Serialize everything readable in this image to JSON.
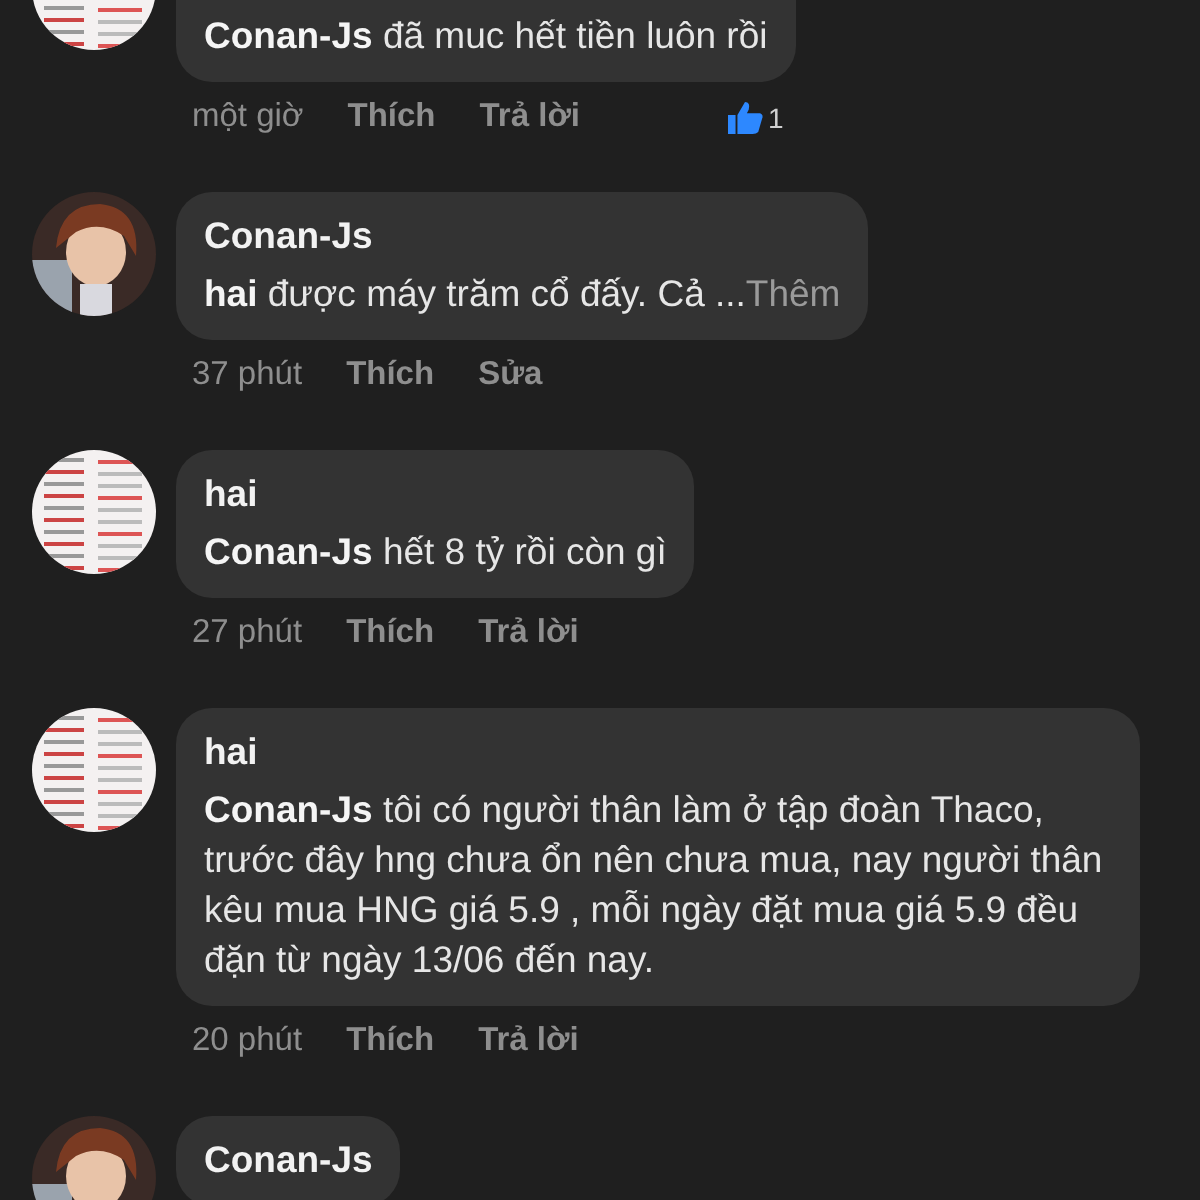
{
  "comments": [
    {
      "avatar": {
        "kind": "collage"
      },
      "tag": "Conan-Js",
      "text": "đã muc hết tiền luôn rồi",
      "meta": {
        "time": "một giờ",
        "actions": [
          "Thích",
          "Trả lời"
        ]
      },
      "reactions": {
        "count": "1"
      }
    },
    {
      "avatar": {
        "kind": "portrait"
      },
      "author": "Conan-Js",
      "tag": "hai",
      "text": "được máy trăm cổ đấy. Cả ...",
      "more": "Thêm",
      "meta": {
        "time": "37 phút",
        "actions": [
          "Thích",
          "Sửa"
        ]
      }
    },
    {
      "avatar": {
        "kind": "collage"
      },
      "author": "hai",
      "tag": "Conan-Js",
      "text": "hết 8 tỷ rồi còn gì",
      "meta": {
        "time": "27 phút",
        "actions": [
          "Thích",
          "Trả lời"
        ]
      }
    },
    {
      "avatar": {
        "kind": "collage"
      },
      "author": "hai",
      "tag": "Conan-Js",
      "text": "tôi có người thân làm ở tập đoàn Thaco, trước đây hng chưa ổn nên chưa mua, nay người thân kêu mua  HNG giá 5.9 , mỗi ngày đặt mua giá 5.9 đều đặn từ ngày 13/06 đến nay.",
      "meta": {
        "time": "20 phút",
        "actions": [
          "Thích",
          "Trả lời"
        ]
      }
    },
    {
      "avatar": {
        "kind": "portrait"
      },
      "author": "Conan-Js"
    }
  ]
}
